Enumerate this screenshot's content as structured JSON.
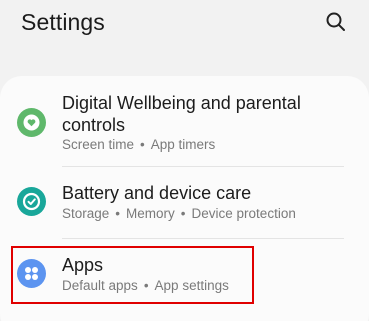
{
  "header": {
    "title": "Settings",
    "search_icon": "search-icon"
  },
  "items": [
    {
      "label_line1": "Digital Wellbeing and parental",
      "label_line2": "controls",
      "sub1": "Screen time",
      "sub2": "App timers",
      "icon": "digital-wellbeing-icon",
      "color": "#5fb86b"
    },
    {
      "label": "Battery and device care",
      "sub1": "Storage",
      "sub2": "Memory",
      "sub3": "Device protection",
      "icon": "device-care-icon",
      "color": "#19a79a"
    },
    {
      "label": "Apps",
      "sub1": "Default apps",
      "sub2": "App settings",
      "icon": "apps-icon",
      "color": "#5c94f0"
    }
  ],
  "separator": "•",
  "highlight_color": "#e00000"
}
